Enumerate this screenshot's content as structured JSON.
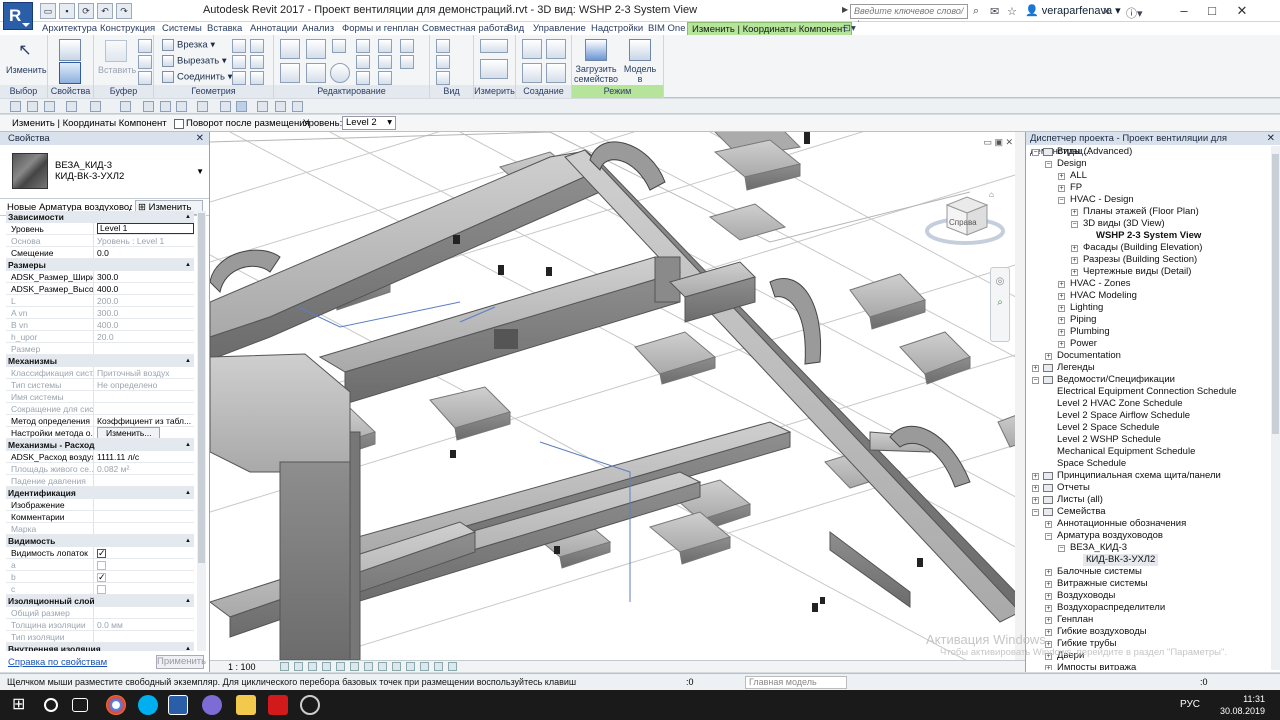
{
  "app": {
    "title": "Autodesk Revit 2017 -    Проект вентиляции для демонстраций.rvt - 3D вид: WSHP 2-3 System View",
    "logo": "R",
    "search_placeholder": "Введите ключевое слово/фразу",
    "user": "veraparfenava"
  },
  "tabs": [
    "Архитектура",
    "Конструкция",
    "Системы",
    "Вставка",
    "Аннотации",
    "Анализ",
    "Формы и генплан",
    "Совместная работа",
    "Вид",
    "Управление",
    "Надстройки",
    "BIM One",
    "Изменить | Координаты Компонент"
  ],
  "ribbon": {
    "panels": [
      "Выбор",
      "Свойства",
      "Буфер обмена",
      "Геометрия",
      "Редактирование",
      "Вид",
      "Измерить",
      "Создание",
      "Режим"
    ],
    "buttons": {
      "modify": "Изменить",
      "paste": "Вставить",
      "load_family": [
        "Загрузить",
        "семейство"
      ],
      "model_in_context": [
        "Модель",
        "в контексте"
      ]
    },
    "geometry_items": [
      "Врезка",
      "Вырезать",
      "Соединить"
    ]
  },
  "options_bar": {
    "context": "Изменить | Координаты Компонент",
    "rotate_label": "Поворот после размещения",
    "level_label": "Уровень:",
    "level_value": "Level 2"
  },
  "properties": {
    "header": "Свойства",
    "type_line1": "ВЕЗА_КИД-3",
    "type_line2": "КИД-ВК-3-УХЛ2",
    "instance_selector": "Новые Арматура воздуховод",
    "edit_type": "Изменить тип",
    "groups": [
      {
        "name": "Зависимости",
        "rows": [
          {
            "n": "Уровень",
            "v": "Level 1",
            "box": true
          },
          {
            "n": "Основа",
            "v": "Уровень : Level 1",
            "grey": true
          },
          {
            "n": "Смещение",
            "v": "0.0"
          }
        ]
      },
      {
        "name": "Размеры",
        "rows": [
          {
            "n": "ADSK_Размер_Ширина",
            "v": "300.0"
          },
          {
            "n": "ADSK_Размер_Высота",
            "v": "400.0"
          },
          {
            "n": "L",
            "v": "200.0",
            "grey": true
          },
          {
            "n": "A vn",
            "v": "300.0",
            "grey": true
          },
          {
            "n": "B vn",
            "v": "400.0",
            "grey": true
          },
          {
            "n": "h_upor",
            "v": "20.0",
            "grey": true
          },
          {
            "n": "Размер",
            "v": "",
            "grey": true
          }
        ]
      },
      {
        "name": "Механизмы",
        "rows": [
          {
            "n": "Классификация сист...",
            "v": "Приточный воздух",
            "grey": true
          },
          {
            "n": "Тип системы",
            "v": "Не определено",
            "grey": true
          },
          {
            "n": "Имя системы",
            "v": "",
            "grey": true
          },
          {
            "n": "Сокращение для сис...",
            "v": "",
            "grey": true
          },
          {
            "n": "Метод определения ...",
            "v": "Коэффициент из табл..."
          },
          {
            "n": "Настройки метода о...",
            "v": "Изменить...",
            "btn": true
          }
        ]
      },
      {
        "name": "Механизмы - Расход",
        "rows": [
          {
            "n": "ADSK_Расход воздуха",
            "v": "1111.11 л/с"
          },
          {
            "n": "Площадь живого се...",
            "v": "0.082 м²",
            "grey": true
          },
          {
            "n": "Падение давления",
            "v": "",
            "grey": true
          }
        ]
      },
      {
        "name": "Идентификация",
        "rows": [
          {
            "n": "Изображение",
            "v": ""
          },
          {
            "n": "Комментарии",
            "v": ""
          },
          {
            "n": "Марка",
            "v": "",
            "grey": true
          }
        ]
      },
      {
        "name": "Видимость",
        "rows": [
          {
            "n": "Видимость лопаток",
            "v": "",
            "cb": "on"
          },
          {
            "n": "a",
            "v": "",
            "cb": "off",
            "grey": true
          },
          {
            "n": "b",
            "v": "",
            "cb": "offchk",
            "grey": true
          },
          {
            "n": "c",
            "v": "",
            "cb": "off",
            "grey": true
          }
        ]
      },
      {
        "name": "Изоляционный слой",
        "rows": [
          {
            "n": "Общий размер",
            "v": "",
            "grey": true
          },
          {
            "n": "Толщина изоляции",
            "v": "0.0 мм",
            "grey": true
          },
          {
            "n": "Тип изоляции",
            "v": "",
            "grey": true
          }
        ]
      },
      {
        "name": "Внутренняя изоляция",
        "rows": []
      }
    ],
    "help_link": "Справка по свойствам",
    "apply": "Применить"
  },
  "viewport": {
    "scale": "1 : 100",
    "viewcube_face": "Справа"
  },
  "browser": {
    "header": "Диспетчер проекта - Проект вентиляции для демонстрац...",
    "nodes": [
      {
        "t": "Виды (Advanced)",
        "l": 0,
        "g": "-"
      },
      {
        "t": "Design",
        "l": 1,
        "g": "-"
      },
      {
        "t": "ALL",
        "l": 2,
        "g": "+"
      },
      {
        "t": "FP",
        "l": 2,
        "g": "+"
      },
      {
        "t": "HVAC - Design",
        "l": 2,
        "g": "-"
      },
      {
        "t": "Планы этажей (Floor Plan)",
        "l": 3,
        "g": "+"
      },
      {
        "t": "3D виды (3D View)",
        "l": 3,
        "g": "-"
      },
      {
        "t": "WSHP 2-3 System View",
        "l": 4,
        "g": "",
        "b": true
      },
      {
        "t": "Фасады (Building Elevation)",
        "l": 3,
        "g": "+"
      },
      {
        "t": "Разрезы (Building Section)",
        "l": 3,
        "g": "+"
      },
      {
        "t": "Чертежные виды (Detail)",
        "l": 3,
        "g": "+"
      },
      {
        "t": "HVAC - Zones",
        "l": 2,
        "g": "+"
      },
      {
        "t": "HVAC Modeling",
        "l": 2,
        "g": "+"
      },
      {
        "t": "Lighting",
        "l": 2,
        "g": "+"
      },
      {
        "t": "Piping",
        "l": 2,
        "g": "+"
      },
      {
        "t": "Plumbing",
        "l": 2,
        "g": "+"
      },
      {
        "t": "Power",
        "l": 2,
        "g": "+"
      },
      {
        "t": "Documentation",
        "l": 1,
        "g": "+"
      },
      {
        "t": "Легенды",
        "l": 0,
        "g": "+"
      },
      {
        "t": "Ведомости/Спецификации",
        "l": 0,
        "g": "-"
      },
      {
        "t": "Electrical Equipment Connection Schedule",
        "l": 1,
        "g": ""
      },
      {
        "t": "Level 2 HVAC Zone Schedule",
        "l": 1,
        "g": ""
      },
      {
        "t": "Level 2 Space Airflow Schedule",
        "l": 1,
        "g": ""
      },
      {
        "t": "Level 2 Space Schedule",
        "l": 1,
        "g": ""
      },
      {
        "t": "Level 2 WSHP Schedule",
        "l": 1,
        "g": ""
      },
      {
        "t": "Mechanical Equipment Schedule",
        "l": 1,
        "g": ""
      },
      {
        "t": "Space Schedule",
        "l": 1,
        "g": ""
      },
      {
        "t": "Принципиальная схема щита/панели",
        "l": 0,
        "g": "+"
      },
      {
        "t": "Отчеты",
        "l": 0,
        "g": "+"
      },
      {
        "t": "Листы (all)",
        "l": 0,
        "g": "+"
      },
      {
        "t": "Семейства",
        "l": 0,
        "g": "-"
      },
      {
        "t": "Аннотационные обозначения",
        "l": 1,
        "g": "+"
      },
      {
        "t": "Арматура воздуховодов",
        "l": 1,
        "g": "-"
      },
      {
        "t": "ВЕЗА_КИД-3",
        "l": 2,
        "g": "-"
      },
      {
        "t": "КИД-ВК-3-УХЛ2",
        "l": 3,
        "g": "",
        "sel": true
      },
      {
        "t": "Балочные системы",
        "l": 1,
        "g": "+"
      },
      {
        "t": "Витражные системы",
        "l": 1,
        "g": "+"
      },
      {
        "t": "Воздуховоды",
        "l": 1,
        "g": "+"
      },
      {
        "t": "Воздухораспределители",
        "l": 1,
        "g": "+"
      },
      {
        "t": "Генплан",
        "l": 1,
        "g": "+"
      },
      {
        "t": "Гибкие воздуховоды",
        "l": 1,
        "g": "+"
      },
      {
        "t": "Гибкие трубы",
        "l": 1,
        "g": "+"
      },
      {
        "t": "Двери",
        "l": 1,
        "g": "+"
      },
      {
        "t": "Импосты витража",
        "l": 1,
        "g": "+"
      }
    ]
  },
  "status": {
    "message": "Щелчком мыши разместите свободный экземпляр. Для циклического перебора базовых точек при размещении воспользуйтесь клавиш",
    "zero": ":0",
    "model": "Главная модель",
    "filter_count": ":0"
  },
  "watermark": {
    "line1": "Активация Windows",
    "line2": "Чтобы активировать Windows, перейдите в раздел \"Параметры\"."
  },
  "taskbar": {
    "lang": "РУС",
    "time": "11:31",
    "date": "30.08.2019"
  }
}
